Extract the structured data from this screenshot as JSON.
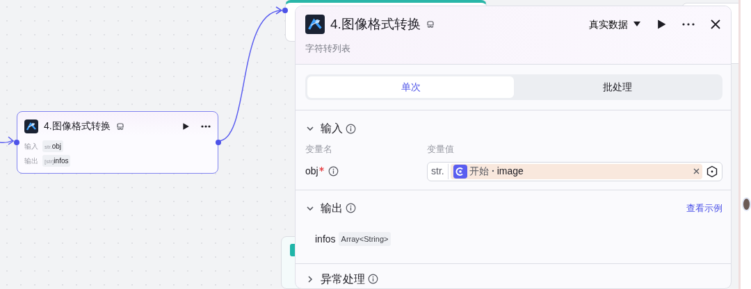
{
  "canvas_node": {
    "title": "4.图像格式转换",
    "rows": [
      {
        "label": "输入",
        "type": "str.",
        "name": "obj"
      },
      {
        "label": "输出",
        "type": "[str]",
        "name": "infos"
      }
    ]
  },
  "panel": {
    "title": "4.图像格式转换",
    "subtitle": "字符转列表",
    "data_source": "真实数据",
    "tabs": [
      {
        "label": "单次",
        "selected": true
      },
      {
        "label": "批处理",
        "selected": false
      }
    ],
    "input_section": {
      "title": "输入",
      "expanded": true,
      "columns": [
        "变量名",
        "变量值"
      ],
      "params": [
        {
          "name": "obj",
          "required": true,
          "type": "str.",
          "source": "开始",
          "field": "image"
        }
      ]
    },
    "output_section": {
      "title": "输出",
      "expanded": true,
      "link": "查看示例",
      "outputs": [
        {
          "name": "infos",
          "type": "Array<String>"
        }
      ]
    },
    "error_section": {
      "title": "异常处理",
      "expanded": false
    }
  }
}
